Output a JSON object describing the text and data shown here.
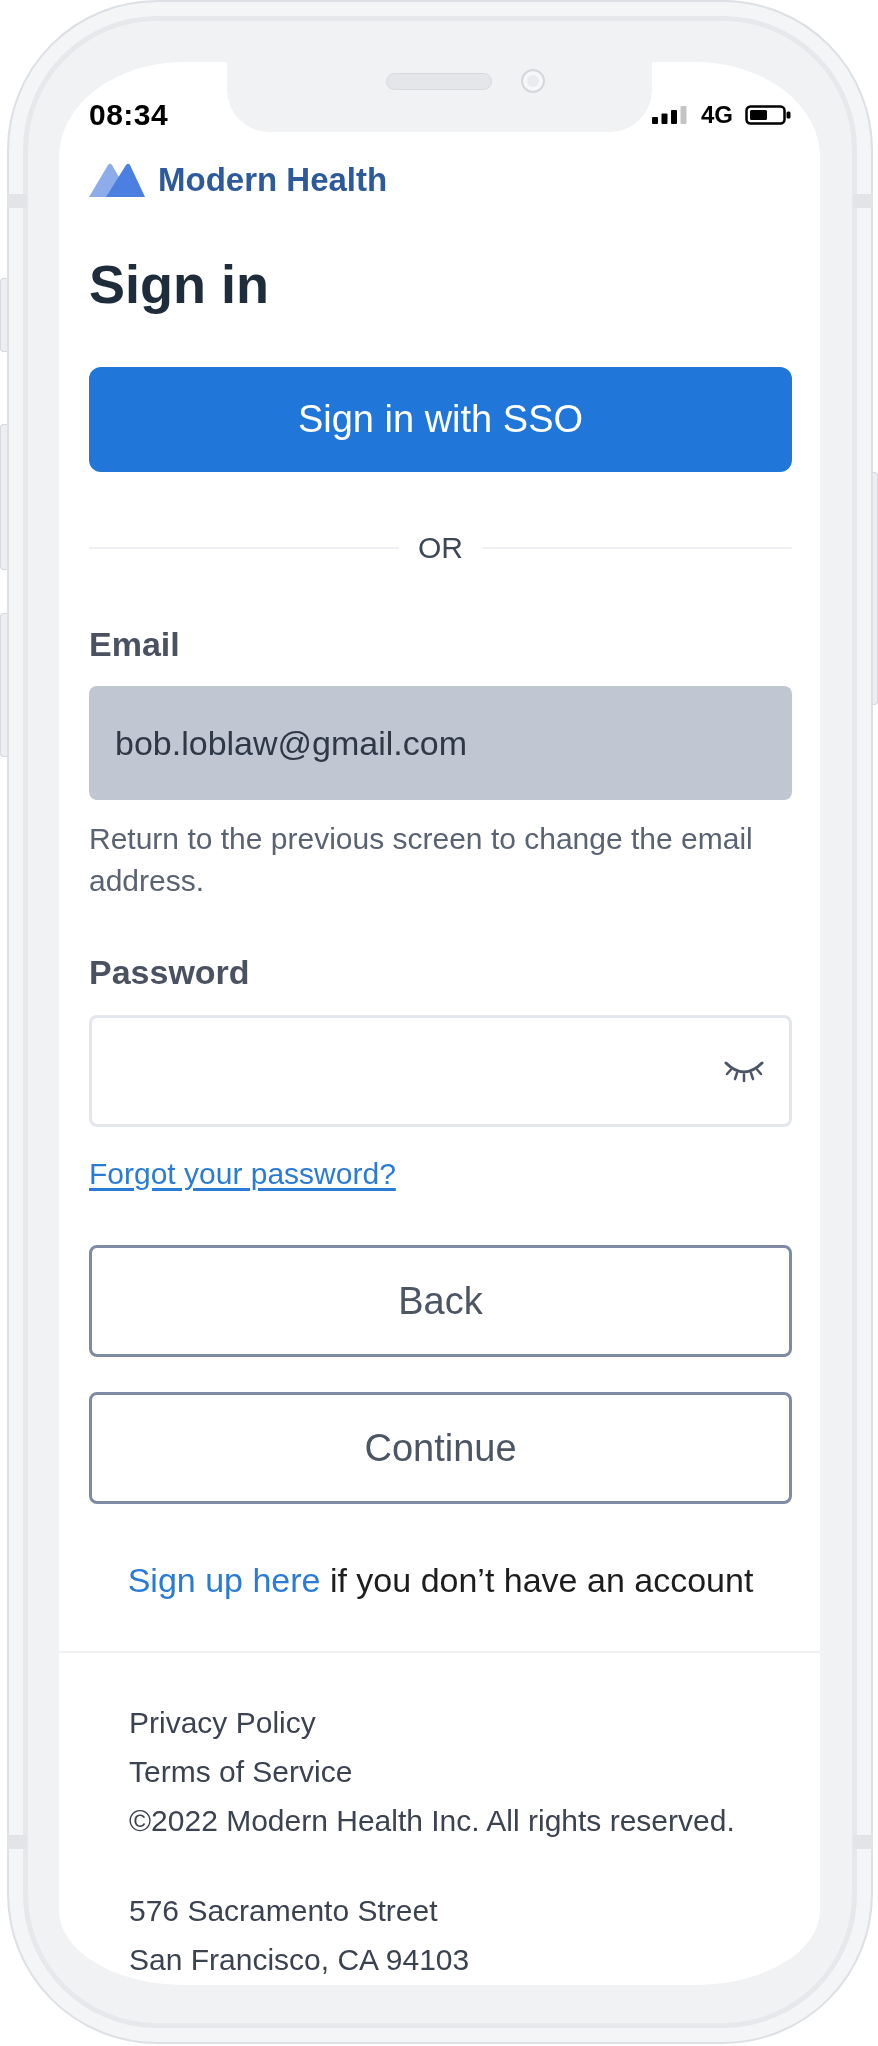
{
  "status_bar": {
    "time": "08:34",
    "network": "4G"
  },
  "brand": {
    "name": "Modern Health"
  },
  "title": "Sign in",
  "sso_button": {
    "label": "Sign in with SSO"
  },
  "divider": {
    "label": "OR"
  },
  "email": {
    "label": "Email",
    "value": "bob.loblaw@gmail.com",
    "disabled": true,
    "help": "Return to the previous screen to change the email address."
  },
  "password": {
    "label": "Password"
  },
  "forgot_link": "Forgot your password?",
  "buttons": [
    {
      "label": "Back"
    },
    {
      "label": "Continue"
    }
  ],
  "signup": {
    "link": "Sign up here",
    "text": "if you don’t have an account"
  },
  "footer": {
    "links": [
      "Privacy Policy",
      "Terms of Service"
    ],
    "copyright": "©2022 Modern Health Inc. All rights reserved.",
    "address": [
      "576 Sacramento Street",
      "San Francisco, CA 94103"
    ]
  }
}
